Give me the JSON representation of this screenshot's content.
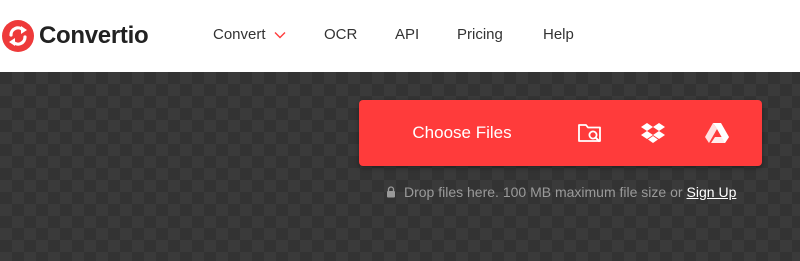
{
  "brand": {
    "name": "Convertio",
    "accent": "#ff3b3b"
  },
  "nav": {
    "items": [
      {
        "label": "Convert",
        "has_dropdown": true
      },
      {
        "label": "OCR"
      },
      {
        "label": "API"
      },
      {
        "label": "Pricing"
      },
      {
        "label": "Help"
      }
    ]
  },
  "upload": {
    "choose_label": "Choose Files",
    "icons": [
      "folder-search-icon",
      "dropbox-icon",
      "google-drive-icon"
    ],
    "hint_text": "Drop files here. 100 MB maximum file size or",
    "signup_label": "Sign Up"
  },
  "colors": {
    "hero_bg": "#333333",
    "button": "#ff3b3b",
    "hint_text": "#9a9a9a"
  }
}
